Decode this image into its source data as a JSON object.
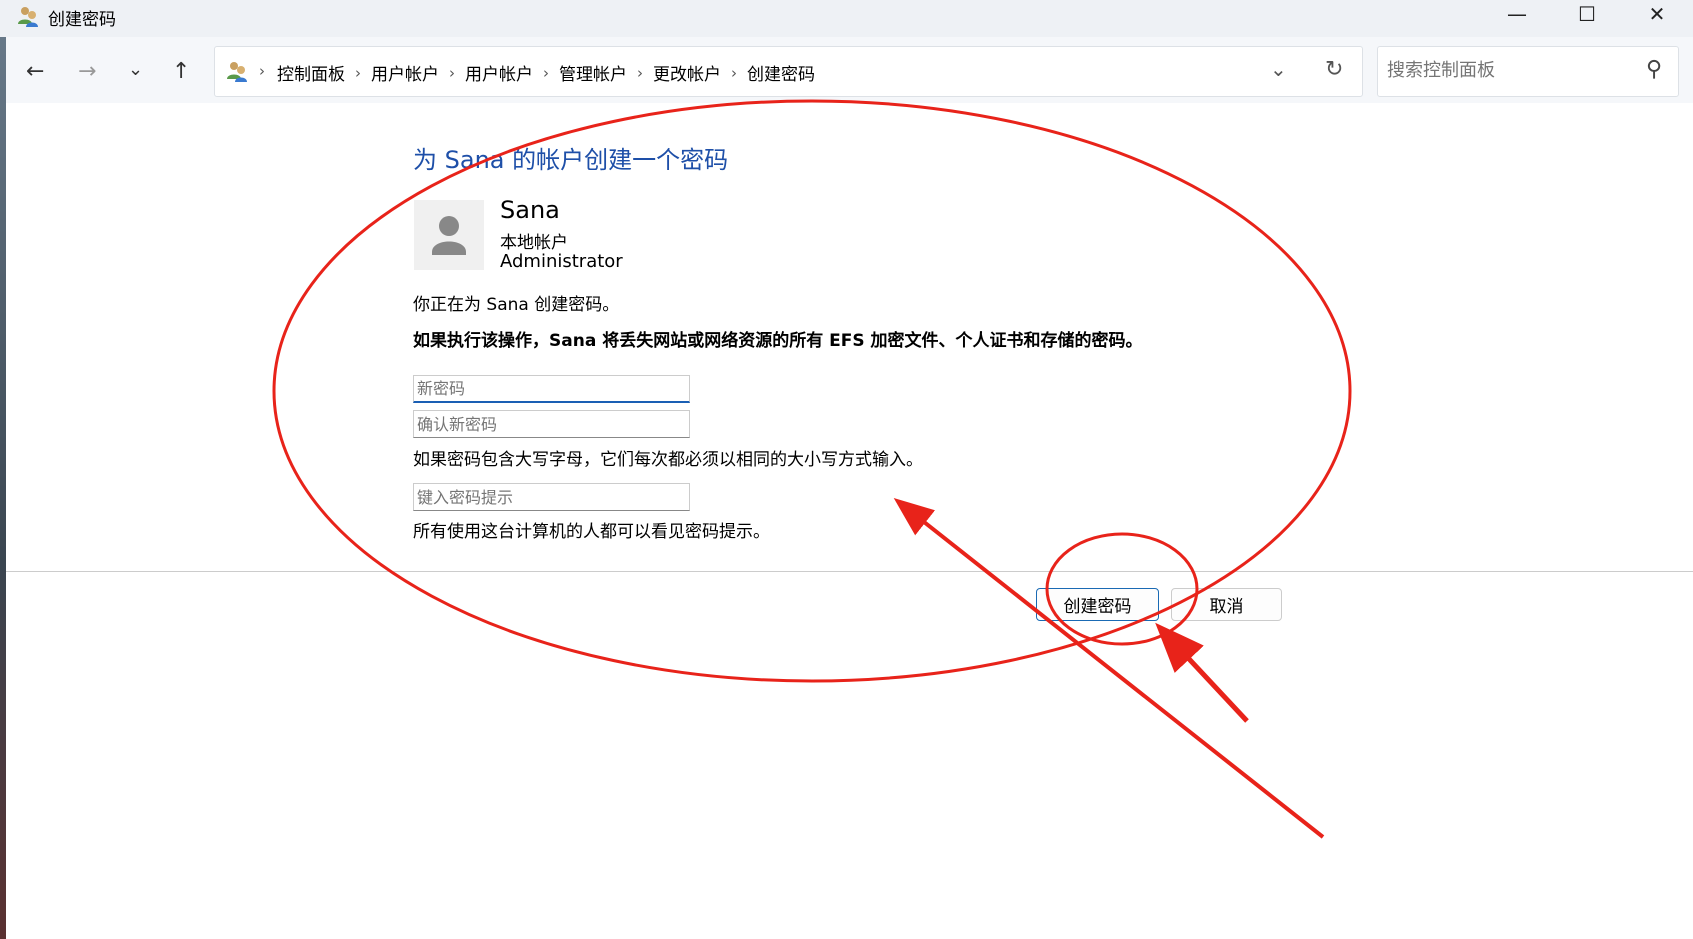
{
  "window": {
    "title": "创建密码",
    "minimize": "—",
    "maximize": "☐",
    "close": "✕"
  },
  "nav": {
    "back": "←",
    "forward": "→",
    "recent": "⌄",
    "up": "↑",
    "dropdown": "⌄",
    "refresh": "↻"
  },
  "breadcrumb": [
    "控制面板",
    "用户帐户",
    "用户帐户",
    "管理帐户",
    "更改帐户",
    "创建密码"
  ],
  "breadcrumb_sep": "›",
  "search": {
    "placeholder": "搜索控制面板",
    "icon": "⚲"
  },
  "page": {
    "heading": "为 Sana 的帐户创建一个密码",
    "user": {
      "name": "Sana",
      "type": "本地帐户",
      "role": "Administrator"
    },
    "info": "你正在为 Sana 创建密码。",
    "warning": "如果执行该操作，Sana 将丢失网站或网络资源的所有 EFS 加密文件、个人证书和存储的密码。",
    "new_password_placeholder": "新密码",
    "confirm_password_placeholder": "确认新密码",
    "case_hint": "如果密码包含大写字母，它们每次都必须以相同的大小写方式输入。",
    "hint_placeholder": "键入密码提示",
    "hint_note": "所有使用这台计算机的人都可以看见密码提示。",
    "create_button": "创建密码",
    "cancel_button": "取消"
  },
  "annotation_color": "#e8231a"
}
